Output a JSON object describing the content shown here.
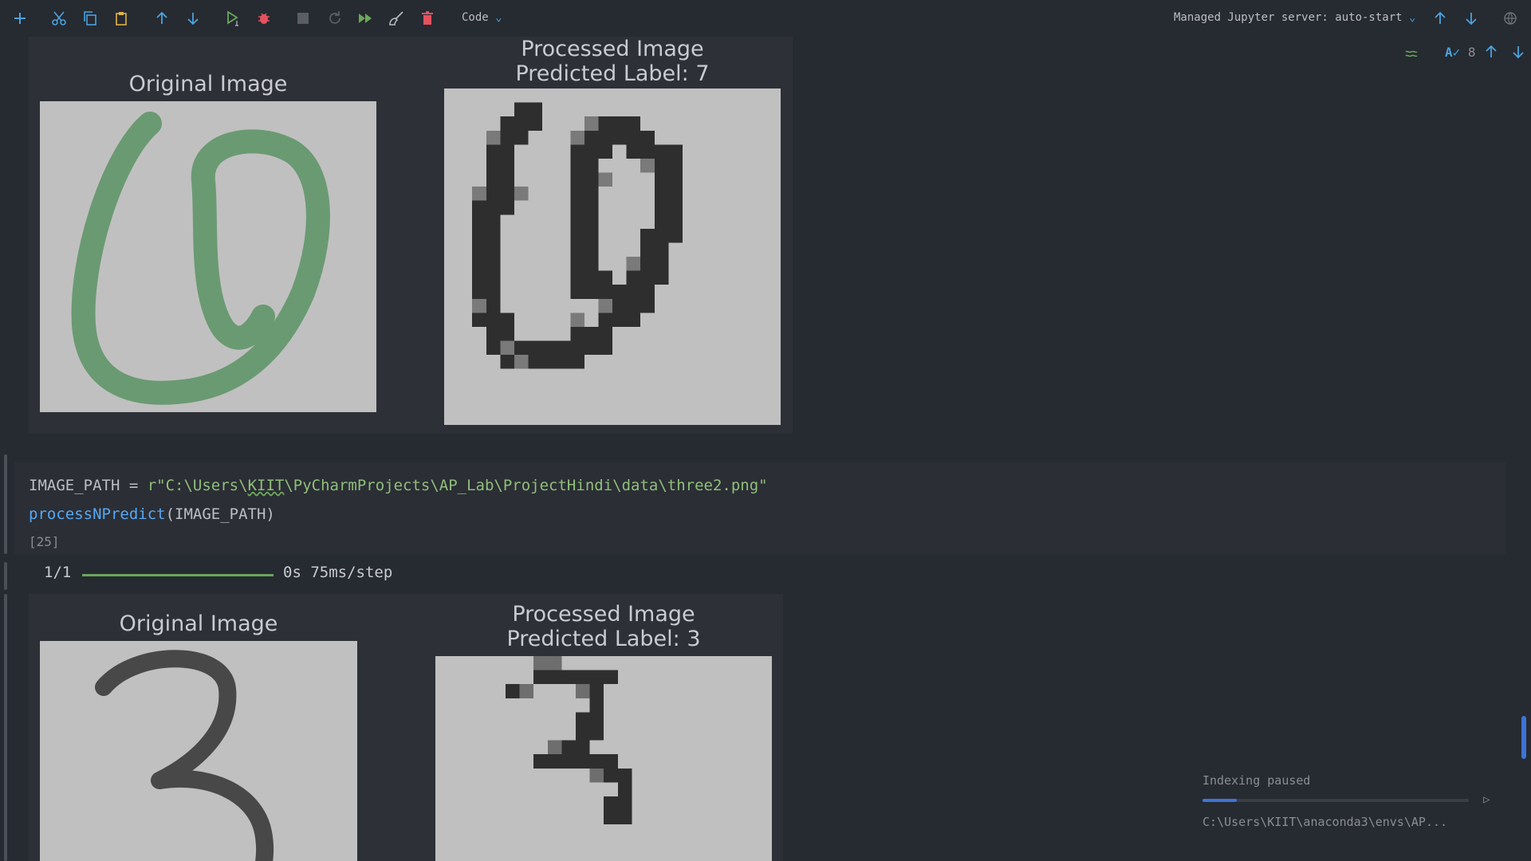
{
  "toolbar": {
    "cell_type": "Code",
    "server_label": "Managed Jupyter server: auto-start",
    "inspection_count": "8"
  },
  "output_top": {
    "original_title": "Original Image",
    "processed_title_line1": "Processed Image",
    "processed_title_line2": "Predicted Label: 7"
  },
  "code_cell": {
    "line1_var": "IMAGE_PATH",
    "line1_op": " = ",
    "line1_str_pre": "r\"C:\\Users\\",
    "line1_str_typo": "KIIT",
    "line1_str_post": "\\PyCharmProjects\\AP_Lab\\ProjectHindi\\data\\three2.png\"",
    "line2_func": "processNPredict",
    "line2_args": "(IMAGE_PATH)",
    "exec_count": "[25]"
  },
  "progress": {
    "count": "1/1",
    "timing": "0s 75ms/step",
    "fraction": 1.0
  },
  "output_bottom": {
    "original_title": "Original Image",
    "processed_title_line1": "Processed Image",
    "processed_title_line2": "Predicted Label: 3"
  },
  "indexing": {
    "status": "Indexing paused",
    "path": "C:\\Users\\KIIT\\anaconda3\\envs\\AP...",
    "progress_fraction": 0.13
  },
  "colors": {
    "accent_blue": "#3d74d6",
    "plus_green": "#5fb6e0",
    "run_green": "#6aa85a",
    "delete_red": "#e5525f",
    "string_green": "#8fbf7a",
    "func_blue": "#56a8f5"
  }
}
